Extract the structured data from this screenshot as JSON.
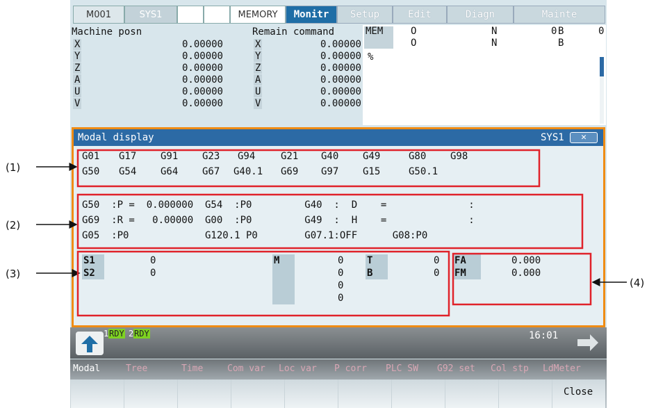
{
  "header": {
    "slot1": "M001",
    "slot2": "SYS1",
    "mode": "MEMORY"
  },
  "tabs": [
    "Monitr",
    "Setup",
    "Edit",
    "Diagn",
    "Mainte"
  ],
  "machine": {
    "title": "Machine posn",
    "axes": [
      "X",
      "Y",
      "Z",
      "A",
      "U",
      "V"
    ],
    "values": [
      "0.00000",
      "0.00000",
      "0.00000",
      "0.00000",
      "0.00000",
      "0.00000"
    ]
  },
  "remain": {
    "title": "Remain command",
    "axes": [
      "X",
      "Y",
      "Z",
      "A",
      "U",
      "V"
    ],
    "values": [
      "0.00000",
      "0.00000",
      "0.00000",
      "0.00000",
      "0.00000",
      "0.00000"
    ]
  },
  "program": {
    "mem": "MEM",
    "o1": "O",
    "n1": "N",
    "num": "0",
    "b1": "B",
    "bval": "0",
    "o2": "O",
    "n2": "N",
    "b2": "B",
    "percent": "%"
  },
  "modal": {
    "title": "Modal display",
    "sys": "SYS1",
    "g_row1": [
      "G01",
      "G17",
      "G91",
      "G23",
      "G94",
      "G21",
      "G40",
      "G49",
      "G80",
      "G98"
    ],
    "g_row2": [
      "G50",
      "G54",
      "G64",
      "G67",
      "G40.1",
      "G69",
      "G97",
      "G15",
      "G50.1"
    ],
    "p_row1": "G50  :P =  0.000000  G54  :P0         G40  :  D    =              :",
    "p_row2": "G69  :R =   0.00000  G00  :P0         G49  :  H    =              :",
    "p_row3": "G05  :P0             G120.1 P0        G07.1:OFF      G08:P0",
    "s1": "S1",
    "s1v": "0",
    "s2": "S2",
    "s2v": "0",
    "m": "M",
    "mvals": [
      "0",
      "0",
      "0",
      "0"
    ],
    "t": "T",
    "tv": "0",
    "b": "B",
    "bv": "0",
    "fa": "FA",
    "fav": "0.000",
    "fm": "FM",
    "fmv": "0.000"
  },
  "callouts": [
    "(1)",
    "(2)",
    "(3)",
    "(4)"
  ],
  "status": {
    "r1": "1",
    "rdy1": "RDY",
    "r2": "2",
    "rdy2": "RDY",
    "time": "16:01"
  },
  "menu": [
    "Modal",
    "Tree",
    "Time",
    "Com var",
    "Loc var",
    "P corr",
    "PLC SW",
    "G92 set",
    "Col stp",
    "LdMeter"
  ],
  "close": "Close"
}
